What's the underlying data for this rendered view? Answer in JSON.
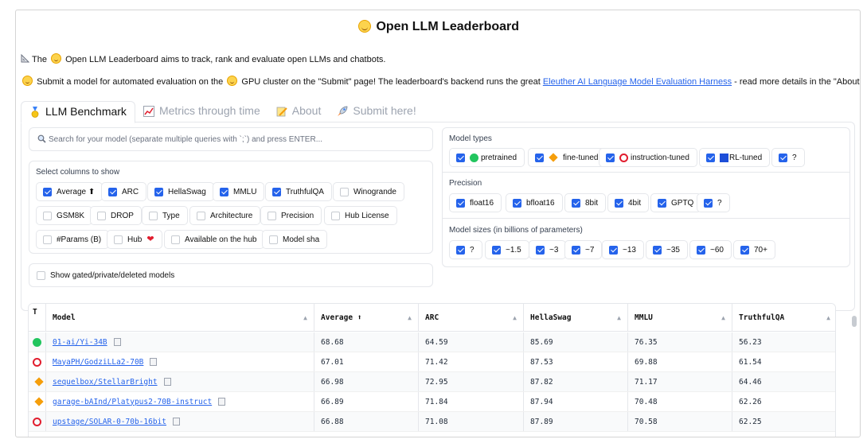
{
  "page": {
    "title": "Open LLM Leaderboard",
    "intro_pre": "The",
    "intro_post": "Open LLM Leaderboard aims to track, rank and evaluate open LLMs and chatbots.",
    "submit_a": "Submit a model for automated evaluation on the",
    "submit_b": "GPU cluster on the \"Submit\" page! The leaderboard's backend runs the great",
    "submit_link": "Eleuther AI Language Model Evaluation Harness",
    "submit_c": "- read more details in the \"About\" page!"
  },
  "tabs": [
    {
      "label": "LLM Benchmark",
      "icon": "medal-icon",
      "active": true
    },
    {
      "label": "Metrics through time",
      "icon": "chart-icon",
      "active": false
    },
    {
      "label": "About",
      "icon": "memo-icon",
      "active": false
    },
    {
      "label": "Submit here!",
      "icon": "rocket-icon",
      "active": false
    }
  ],
  "search": {
    "placeholder": "Search for your model (separate multiple queries with `;`) and press ENTER..."
  },
  "columns": {
    "label": "Select columns to show",
    "items": [
      {
        "label": "Average ⬆",
        "checked": true
      },
      {
        "label": "ARC",
        "checked": true
      },
      {
        "label": "HellaSwag",
        "checked": true
      },
      {
        "label": "MMLU",
        "checked": true
      },
      {
        "label": "TruthfulQA",
        "checked": true
      },
      {
        "label": "Winogrande",
        "checked": false
      },
      {
        "label": "GSM8K",
        "checked": false
      },
      {
        "label": "DROP",
        "checked": false
      },
      {
        "label": "Type",
        "checked": false
      },
      {
        "label": "Architecture",
        "checked": false
      },
      {
        "label": "Precision",
        "checked": false
      },
      {
        "label": "Hub License",
        "checked": false
      },
      {
        "label": "#Params (B)",
        "checked": false
      },
      {
        "label": "Hub",
        "checked": false
      },
      {
        "label": "Available on the hub",
        "checked": false
      },
      {
        "label": "Model sha",
        "checked": false
      }
    ]
  },
  "gated": {
    "label": "Show gated/private/deleted models",
    "checked": false
  },
  "model_types": {
    "label": "Model types",
    "items": [
      {
        "label": "pretrained",
        "icon": "green-circle-icon"
      },
      {
        "label": "fine-tuned",
        "icon": "orange-diamond-icon"
      },
      {
        "label": "instruction-tuned",
        "icon": "red-ring-icon"
      },
      {
        "label": "RL-tuned",
        "icon": "blue-square-icon"
      },
      {
        "label": "?",
        "icon": ""
      }
    ]
  },
  "precision": {
    "label": "Precision",
    "items": [
      "float16",
      "bfloat16",
      "8bit",
      "4bit",
      "GPTQ",
      "?"
    ]
  },
  "sizes": {
    "label": "Model sizes (in billions of parameters)",
    "items": [
      "?",
      "~1.5",
      "~3",
      "~7",
      "~13",
      "~35",
      "~60",
      "70+"
    ]
  },
  "table": {
    "headers": [
      "T",
      "Model",
      "Average ⬆",
      "ARC",
      "HellaSwag",
      "MMLU",
      "TruthfulQA"
    ],
    "rows": [
      {
        "type": "green-circle-icon",
        "model": "01-ai/Yi-34B",
        "average": "68.68",
        "arc": "64.59",
        "hellaswag": "85.69",
        "mmlu": "76.35",
        "truthfulqa": "56.23"
      },
      {
        "type": "red-ring-icon",
        "model": "MayaPH/GodziLLa2-70B",
        "average": "67.01",
        "arc": "71.42",
        "hellaswag": "87.53",
        "mmlu": "69.88",
        "truthfulqa": "61.54"
      },
      {
        "type": "orange-diamond-icon",
        "model": "sequelbox/StellarBright",
        "average": "66.98",
        "arc": "72.95",
        "hellaswag": "87.82",
        "mmlu": "71.17",
        "truthfulqa": "64.46"
      },
      {
        "type": "orange-diamond-icon",
        "model": "garage-bAInd/Platypus2-70B-instruct",
        "average": "66.89",
        "arc": "71.84",
        "hellaswag": "87.94",
        "mmlu": "70.48",
        "truthfulqa": "62.26"
      },
      {
        "type": "red-ring-icon",
        "model": "upstage/SOLAR-0-70b-16bit",
        "average": "66.88",
        "arc": "71.08",
        "hellaswag": "87.89",
        "mmlu": "70.58",
        "truthfulqa": "62.25"
      }
    ]
  },
  "colors": {
    "accent": "#2563eb",
    "link": "#2563eb",
    "border": "#e5e7eb"
  }
}
